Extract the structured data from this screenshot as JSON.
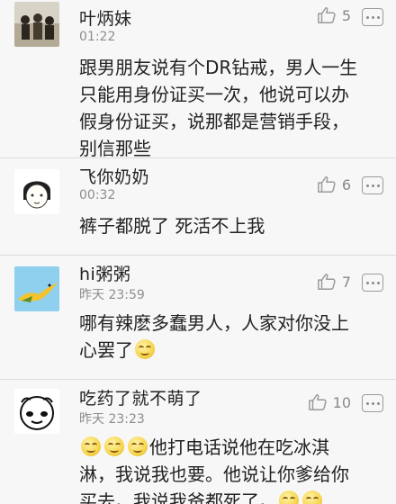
{
  "comments": [
    {
      "username": "叶炳妹",
      "time": "01:22",
      "likes": "5",
      "avatar_icon": "group-photo-avatar",
      "lines": [
        "跟男朋友说有个DR钻戒，男人一生",
        "只能用身份证买一次，他说可以办",
        "假身份证买，说那都是营销手段，",
        "别信那些"
      ]
    },
    {
      "username": "飞你奶奶",
      "time": "00:32",
      "likes": "6",
      "avatar_icon": "cartoon-girl-avatar",
      "lines": [
        "裤子都脱了 死活不上我"
      ]
    },
    {
      "username": "hi粥粥",
      "time": "昨天 23:59",
      "likes": "7",
      "avatar_icon": "bird-avatar",
      "lines": [
        "哪有辣麽多蠢男人，人家对你没上",
        "心罢了"
      ]
    },
    {
      "username": "吃药了就不萌了",
      "time": "昨天 23:23",
      "likes": "10",
      "avatar_icon": "panda-face-avatar",
      "lines": [
        "他打电话说他在吃冰淇",
        "淋，我说我也要。他说让你爹给你",
        "买去。我说我爸都死了。"
      ]
    }
  ],
  "icons": {
    "like": "thumbs-up-icon",
    "more": "more-icon",
    "emoji": "smiley-emoji-icon"
  },
  "colors": {
    "background": "#f7f7f7",
    "divider": "#dcdcdc",
    "text": "#222222",
    "meta": "#8d8d8d"
  }
}
